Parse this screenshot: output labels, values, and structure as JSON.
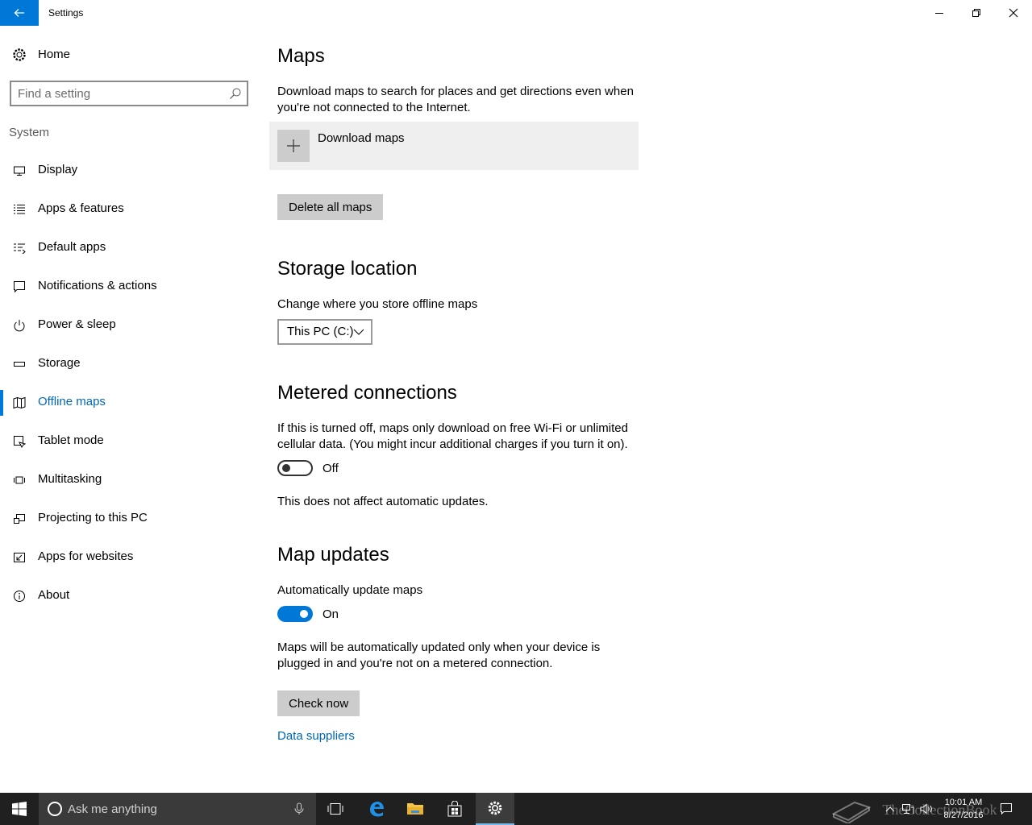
{
  "window": {
    "title": "Settings"
  },
  "sidebar": {
    "home_label": "Home",
    "search_placeholder": "Find a setting",
    "group_label": "System",
    "items": [
      {
        "label": "Display",
        "icon": "monitor-icon"
      },
      {
        "label": "Apps & features",
        "icon": "list-icon"
      },
      {
        "label": "Default apps",
        "icon": "default-apps-icon"
      },
      {
        "label": "Notifications & actions",
        "icon": "notification-icon"
      },
      {
        "label": "Power & sleep",
        "icon": "power-icon"
      },
      {
        "label": "Storage",
        "icon": "storage-icon"
      },
      {
        "label": "Offline maps",
        "icon": "map-icon",
        "active": true
      },
      {
        "label": "Tablet mode",
        "icon": "tablet-icon"
      },
      {
        "label": "Multitasking",
        "icon": "multitasking-icon"
      },
      {
        "label": "Projecting to this PC",
        "icon": "projecting-icon"
      },
      {
        "label": "Apps for websites",
        "icon": "apps-websites-icon"
      },
      {
        "label": "About",
        "icon": "info-icon"
      }
    ]
  },
  "main": {
    "maps": {
      "heading": "Maps",
      "description": "Download maps to search for places and get directions even when you're not connected to the Internet.",
      "download_label": "Download maps",
      "delete_label": "Delete all maps"
    },
    "storage": {
      "heading": "Storage location",
      "description": "Change where you store offline maps",
      "selected": "This PC (C:)"
    },
    "metered": {
      "heading": "Metered connections",
      "description": "If this is turned off, maps only download on free Wi-Fi or unlimited cellular data. (You might incur additional charges if you turn it on).",
      "toggle_state": "Off",
      "note": "This does not affect automatic updates."
    },
    "updates": {
      "heading": "Map updates",
      "auto_label": "Automatically update maps",
      "toggle_state": "On",
      "description": "Maps will be automatically updated only when your device is plugged in and you're not on a metered connection.",
      "check_label": "Check now",
      "suppliers_link": "Data suppliers"
    }
  },
  "taskbar": {
    "search_placeholder": "Ask me anything",
    "time": "10:01 AM",
    "date": "8/27/2016",
    "watermark": "TheCollectionBook"
  },
  "colors": {
    "accent": "#0078d7",
    "link": "#0067b8",
    "taskbar": "#202020"
  }
}
